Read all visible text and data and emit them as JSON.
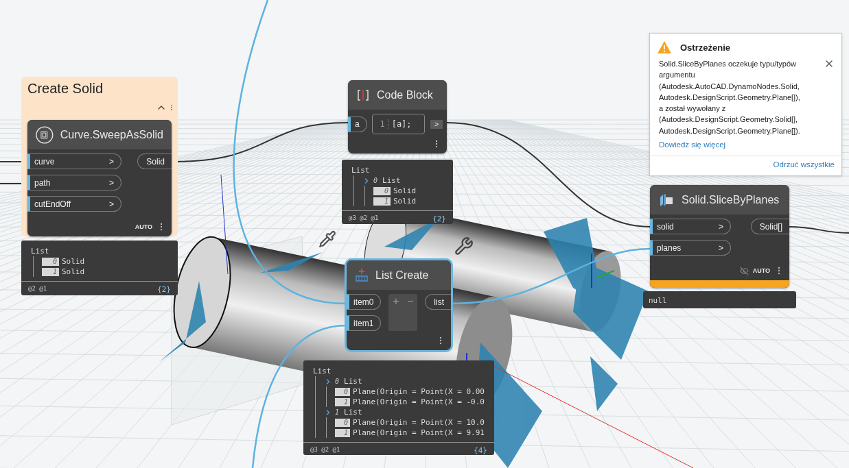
{
  "group": {
    "title": "Create Solid",
    "nodes": [
      {
        "kind": "sweep",
        "title": "Curve.SweepAsSolid",
        "selected": false,
        "warning": false,
        "inputs": [
          {
            "label": "curve",
            "marker": ">"
          },
          {
            "label": "path",
            "marker": ">"
          },
          {
            "label": "cutEndOff",
            "marker": ">"
          }
        ],
        "outputs": [
          {
            "label": "Solid"
          }
        ],
        "lacing": "AUTO",
        "preview": {
          "tree": {
            "label": "List",
            "children": [
              {
                "index": "0",
                "value": "Solid"
              },
              {
                "index": "1",
                "value": "Solid"
              }
            ]
          },
          "levels": "@2 @1",
          "count": "{2}"
        }
      }
    ]
  },
  "nodes": [
    {
      "kind": "code_block",
      "title": "Code Block",
      "selected": false,
      "warning": false,
      "inputs": [
        {
          "label": "a"
        }
      ],
      "code": {
        "line": "1",
        "text": "[a];"
      },
      "outputs": [
        {
          "label": ">"
        }
      ],
      "preview": {
        "tree": {
          "label": "List",
          "children": [
            {
              "index": "0",
              "label": "List",
              "children": [
                {
                  "index": "0",
                  "value": "Solid"
                },
                {
                  "index": "1",
                  "value": "Solid"
                }
              ]
            }
          ]
        },
        "levels": "@3 @2 @1",
        "count": "{2}"
      }
    },
    {
      "kind": "slice",
      "title": "Solid.SliceByPlanes",
      "selected": false,
      "warning": true,
      "inputs": [
        {
          "label": "solid",
          "marker": ">"
        },
        {
          "label": "planes",
          "marker": ">"
        }
      ],
      "outputs": [
        {
          "label": "Solid[]"
        }
      ],
      "lacing": "AUTO",
      "preview_hidden": true,
      "preview": {
        "tree": {
          "value": "null"
        }
      }
    },
    {
      "kind": "list_create",
      "title": "List Create",
      "selected": true,
      "warning": false,
      "inputs": [
        {
          "label": "item0"
        },
        {
          "label": "item1"
        }
      ],
      "add_remove": [
        "+",
        "−"
      ],
      "outputs": [
        {
          "label": "list"
        }
      ],
      "preview": {
        "tree": {
          "label": "List",
          "children": [
            {
              "index": "0",
              "label": "List",
              "children": [
                {
                  "index": "0",
                  "value": "Plane(Origin = Point(X = 0.00"
                },
                {
                  "index": "1",
                  "value": "Plane(Origin = Point(X = -0.0"
                }
              ]
            },
            {
              "index": "1",
              "label": "List",
              "children": [
                {
                  "index": "0",
                  "value": "Plane(Origin = Point(X = 10.0"
                },
                {
                  "index": "1",
                  "value": "Plane(Origin = Point(X = 9.91"
                }
              ]
            }
          ]
        },
        "levels": "@3 @2 @1",
        "count": "{4}"
      }
    }
  ],
  "warning": {
    "title": "Ostrzeżenie",
    "message": "Solid.SliceByPlanes oczekuje typu/typów\nargumentu\n(Autodesk.AutoCAD.DynamoNodes.Solid,\nAutodesk.DesignScript.Geometry.Plane[]),\na został wywołany z\n(Autodesk.DesignScript.Geometry.Solid[],\nAutodesk.DesignScript.Geometry.Plane[]).",
    "link": "Dowiedz się więcej",
    "action": "Odrzuć wszystkie"
  }
}
